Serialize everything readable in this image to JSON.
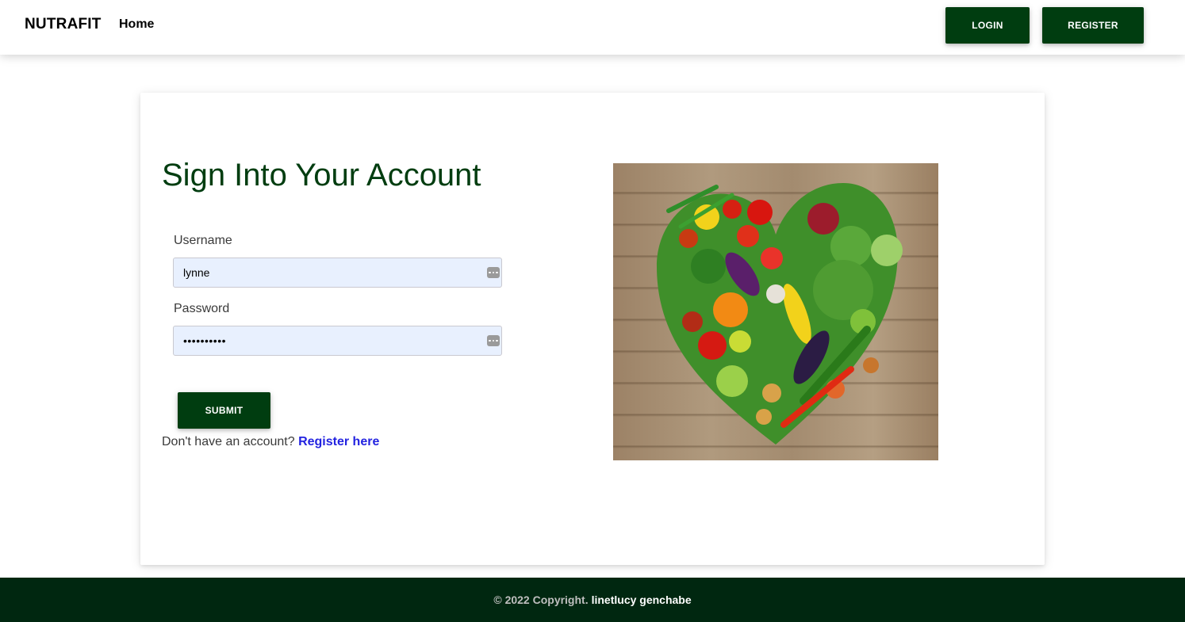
{
  "navbar": {
    "brand": "NUTRAFIT",
    "home": "Home",
    "login": "LOGIN",
    "register": "REGISTER"
  },
  "form": {
    "title": "Sign Into Your Account",
    "username_label": "Username",
    "username_value": "lynne",
    "password_label": "Password",
    "password_value": "••••••••••",
    "submit": "SUBMIT",
    "no_account": "Don't have an account?",
    "register_link": "Register here"
  },
  "image": {
    "icon": "vegetable-heart-photo"
  },
  "footer": {
    "copyright": "© 2022 Copyright.",
    "author": "linetlucy genchabe"
  },
  "colors": {
    "brand_dark_green": "#003d10",
    "footer_bg": "#002710",
    "link": "#2323e0",
    "input_bg": "#e8f0fe"
  }
}
